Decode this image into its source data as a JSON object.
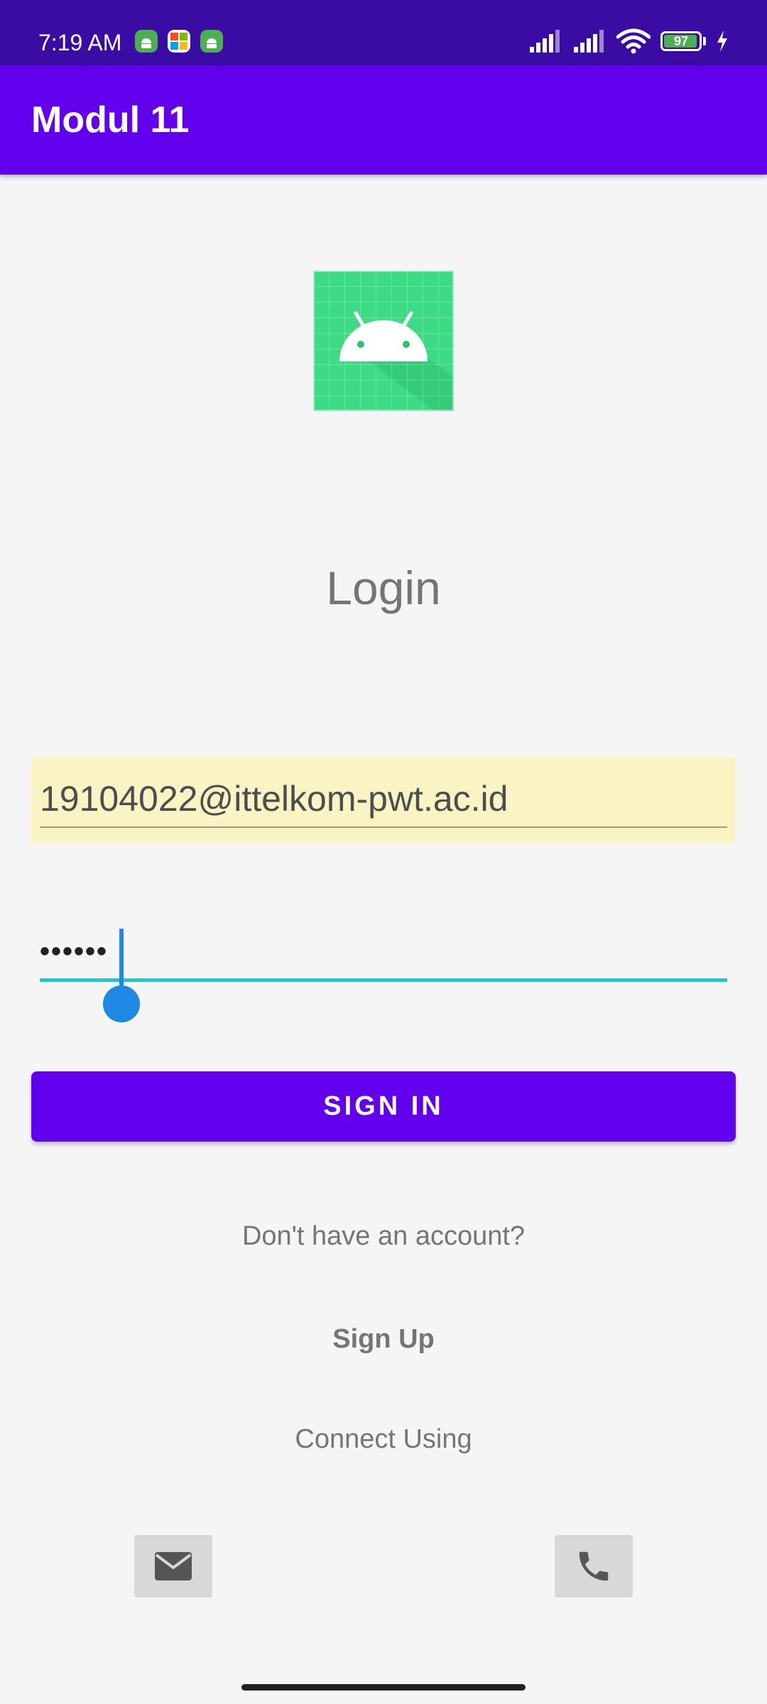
{
  "status_bar": {
    "time": "7:19 AM",
    "notification_icons": [
      "android-app-icon",
      "microsoft-icon",
      "android-app-icon"
    ],
    "signal_icons": [
      "cellular-signal-icon",
      "cellular-signal-icon",
      "wifi-icon"
    ],
    "battery_level": "97",
    "charging": true
  },
  "app_bar": {
    "title": "Modul 11"
  },
  "logo": {
    "icon": "android-logo-icon"
  },
  "login": {
    "title": "Login",
    "email_value": "19104022@ittelkom-pwt.ac.id",
    "password_value": "••••••",
    "sign_in_label": "SIGN IN",
    "no_account_text": "Don't have an account?",
    "sign_up_label": "Sign Up",
    "connect_using_text": "Connect Using"
  },
  "social": {
    "email_icon": "mail-icon",
    "phone_icon": "phone-icon"
  },
  "colors": {
    "status_bar": "#3a0ca3",
    "primary": "#6200ee",
    "autofill_background": "#faf3c4",
    "focus_underline": "#26c6c6",
    "caret": "#1e88e5",
    "logo_green": "#3ddc84"
  }
}
